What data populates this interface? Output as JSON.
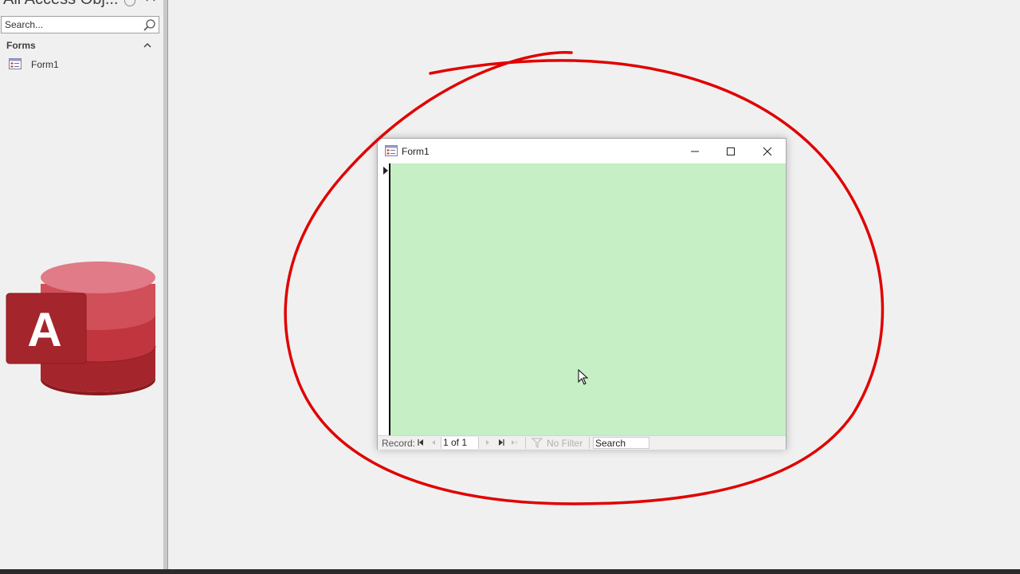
{
  "nav_pane": {
    "title": "All Access Obj...",
    "search_placeholder": "Search...",
    "groups": [
      {
        "label": "Forms",
        "items": [
          {
            "label": "Form1",
            "icon": "form-icon"
          }
        ]
      }
    ]
  },
  "logo": {
    "letter": "A",
    "icon": "access-logo"
  },
  "form_window": {
    "title": "Form1",
    "detail_color": "#c6efc6",
    "nav_bar": {
      "record_label": "Record:",
      "current_record": "1 of 1",
      "filter_label": "No Filter",
      "search_placeholder": "Search"
    }
  },
  "annotation": {
    "color": "#e00000",
    "shape": "hand-drawn-circle"
  }
}
